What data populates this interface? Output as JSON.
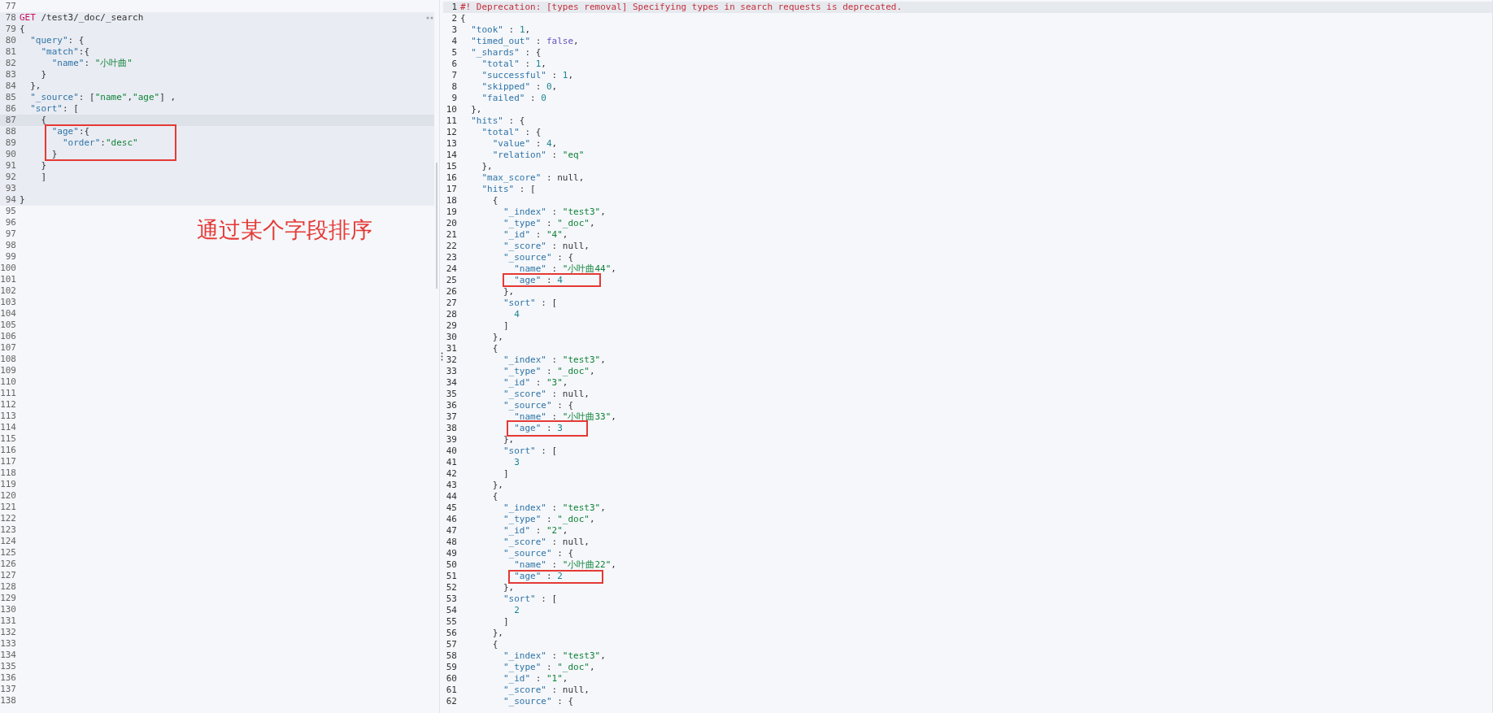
{
  "request_editor": {
    "lines_above": [
      {
        "n": "77"
      }
    ],
    "request": {
      "lines": [
        {
          "n": "78",
          "current": false,
          "code": [
            {
              "kind": "method",
              "text": "GET"
            },
            {
              "kind": "path",
              "text": " /test3/_doc/_search"
            }
          ]
        },
        {
          "n": "79",
          "current": false,
          "code": [
            {
              "kind": "punct",
              "text": "{"
            }
          ]
        },
        {
          "n": "80",
          "current": false,
          "code": [
            {
              "kind": "key",
              "text": "  \"query\""
            },
            {
              "kind": "punct",
              "text": ": {"
            }
          ]
        },
        {
          "n": "81",
          "current": false,
          "code": [
            {
              "kind": "key",
              "text": "    \"match\""
            },
            {
              "kind": "punct",
              "text": ":{"
            }
          ]
        },
        {
          "n": "82",
          "current": false,
          "code": [
            {
              "kind": "key",
              "text": "      \"name\""
            },
            {
              "kind": "punct",
              "text": ": "
            },
            {
              "kind": "str",
              "text": "\"小叶曲\""
            }
          ]
        },
        {
          "n": "83",
          "current": false,
          "code": [
            {
              "kind": "punct",
              "text": "    }"
            }
          ]
        },
        {
          "n": "84",
          "current": false,
          "code": [
            {
              "kind": "punct",
              "text": "  },"
            }
          ]
        },
        {
          "n": "85",
          "current": false,
          "code": [
            {
              "kind": "key",
              "text": "  \"_source\""
            },
            {
              "kind": "punct",
              "text": ": ["
            },
            {
              "kind": "str",
              "text": "\"name\""
            },
            {
              "kind": "punct",
              "text": ","
            },
            {
              "kind": "str",
              "text": "\"age\""
            },
            {
              "kind": "punct",
              "text": "] ,"
            }
          ]
        },
        {
          "n": "86",
          "current": false,
          "code": [
            {
              "kind": "key",
              "text": "  \"sort\""
            },
            {
              "kind": "punct",
              "text": ": ["
            }
          ]
        },
        {
          "n": "87",
          "current": true,
          "code": [
            {
              "kind": "punct",
              "text": "    {"
            }
          ]
        },
        {
          "n": "88",
          "current": false,
          "code": [
            {
              "kind": "key",
              "text": "      \"age\""
            },
            {
              "kind": "punct",
              "text": ":{"
            }
          ]
        },
        {
          "n": "89",
          "current": false,
          "code": [
            {
              "kind": "key",
              "text": "        \"order\""
            },
            {
              "kind": "punct",
              "text": ":"
            },
            {
              "kind": "str",
              "text": "\"desc\""
            }
          ]
        },
        {
          "n": "90",
          "current": false,
          "code": [
            {
              "kind": "punct",
              "text": "      }"
            }
          ]
        },
        {
          "n": "91",
          "current": false,
          "code": [
            {
              "kind": "punct",
              "text": "    }"
            }
          ]
        },
        {
          "n": "92",
          "current": false,
          "code": [
            {
              "kind": "punct",
              "text": "    ]"
            }
          ]
        },
        {
          "n": "93",
          "current": false
        },
        {
          "n": "94",
          "current": false,
          "code": [
            {
              "kind": "punct",
              "text": "}"
            }
          ]
        }
      ]
    },
    "lines_below": [
      {
        "n": "95"
      },
      {
        "n": "96"
      },
      {
        "n": "97"
      },
      {
        "n": "98"
      },
      {
        "n": "99"
      },
      {
        "n": "100"
      },
      {
        "n": "101"
      },
      {
        "n": "102"
      },
      {
        "n": "103"
      },
      {
        "n": "104"
      },
      {
        "n": "105"
      },
      {
        "n": "106"
      },
      {
        "n": "107"
      },
      {
        "n": "108"
      },
      {
        "n": "109"
      },
      {
        "n": "110"
      },
      {
        "n": "111"
      },
      {
        "n": "112"
      },
      {
        "n": "113"
      },
      {
        "n": "114"
      },
      {
        "n": "115"
      },
      {
        "n": "116"
      },
      {
        "n": "117"
      },
      {
        "n": "118"
      },
      {
        "n": "119"
      },
      {
        "n": "120"
      },
      {
        "n": "121"
      },
      {
        "n": "122"
      },
      {
        "n": "123"
      },
      {
        "n": "124"
      },
      {
        "n": "125"
      },
      {
        "n": "126"
      },
      {
        "n": "127"
      },
      {
        "n": "128"
      },
      {
        "n": "129"
      },
      {
        "n": "130"
      },
      {
        "n": "131"
      },
      {
        "n": "132"
      },
      {
        "n": "133"
      },
      {
        "n": "134"
      },
      {
        "n": "135"
      },
      {
        "n": "136"
      },
      {
        "n": "137"
      },
      {
        "n": "138"
      }
    ],
    "annotation": "通过某个字段排序"
  },
  "response_viewer": {
    "warning": {
      "n": "1",
      "text": "#! Deprecation: [types removal] Specifying types in search requests is deprecated."
    },
    "lines": [
      {
        "n": "2",
        "code": [
          {
            "kind": "punct",
            "text": "{"
          }
        ]
      },
      {
        "n": "3",
        "code": [
          {
            "kind": "key",
            "text": "  \"took\""
          },
          {
            "kind": "punct",
            "text": " : "
          },
          {
            "kind": "num",
            "text": "1"
          },
          {
            "kind": "punct",
            "text": ","
          }
        ]
      },
      {
        "n": "4",
        "code": [
          {
            "kind": "key",
            "text": "  \"timed_out\""
          },
          {
            "kind": "punct",
            "text": " : "
          },
          {
            "kind": "bool",
            "text": "false"
          },
          {
            "kind": "punct",
            "text": ","
          }
        ]
      },
      {
        "n": "5",
        "code": [
          {
            "kind": "key",
            "text": "  \"_shards\""
          },
          {
            "kind": "punct",
            "text": " : {"
          }
        ]
      },
      {
        "n": "6",
        "code": [
          {
            "kind": "key",
            "text": "    \"total\""
          },
          {
            "kind": "punct",
            "text": " : "
          },
          {
            "kind": "num",
            "text": "1"
          },
          {
            "kind": "punct",
            "text": ","
          }
        ]
      },
      {
        "n": "7",
        "code": [
          {
            "kind": "key",
            "text": "    \"successful\""
          },
          {
            "kind": "punct",
            "text": " : "
          },
          {
            "kind": "num",
            "text": "1"
          },
          {
            "kind": "punct",
            "text": ","
          }
        ]
      },
      {
        "n": "8",
        "code": [
          {
            "kind": "key",
            "text": "    \"skipped\""
          },
          {
            "kind": "punct",
            "text": " : "
          },
          {
            "kind": "num",
            "text": "0"
          },
          {
            "kind": "punct",
            "text": ","
          }
        ]
      },
      {
        "n": "9",
        "code": [
          {
            "kind": "key",
            "text": "    \"failed\""
          },
          {
            "kind": "punct",
            "text": " : "
          },
          {
            "kind": "num",
            "text": "0"
          }
        ]
      },
      {
        "n": "10",
        "code": [
          {
            "kind": "punct",
            "text": "  },"
          }
        ]
      },
      {
        "n": "11",
        "code": [
          {
            "kind": "key",
            "text": "  \"hits\""
          },
          {
            "kind": "punct",
            "text": " : {"
          }
        ]
      },
      {
        "n": "12",
        "code": [
          {
            "kind": "key",
            "text": "    \"total\""
          },
          {
            "kind": "punct",
            "text": " : {"
          }
        ]
      },
      {
        "n": "13",
        "code": [
          {
            "kind": "key",
            "text": "      \"value\""
          },
          {
            "kind": "punct",
            "text": " : "
          },
          {
            "kind": "num",
            "text": "4"
          },
          {
            "kind": "punct",
            "text": ","
          }
        ]
      },
      {
        "n": "14",
        "code": [
          {
            "kind": "key",
            "text": "      \"relation\""
          },
          {
            "kind": "punct",
            "text": " : "
          },
          {
            "kind": "str",
            "text": "\"eq\""
          }
        ]
      },
      {
        "n": "15",
        "code": [
          {
            "kind": "punct",
            "text": "    },"
          }
        ]
      },
      {
        "n": "16",
        "code": [
          {
            "kind": "key",
            "text": "    \"max_score\""
          },
          {
            "kind": "punct",
            "text": " : null,"
          }
        ]
      },
      {
        "n": "17",
        "code": [
          {
            "kind": "key",
            "text": "    \"hits\""
          },
          {
            "kind": "punct",
            "text": " : ["
          }
        ]
      },
      {
        "n": "18",
        "code": [
          {
            "kind": "punct",
            "text": "      {"
          }
        ]
      },
      {
        "n": "19",
        "code": [
          {
            "kind": "key",
            "text": "        \"_index\""
          },
          {
            "kind": "punct",
            "text": " : "
          },
          {
            "kind": "str",
            "text": "\"test3\""
          },
          {
            "kind": "punct",
            "text": ","
          }
        ]
      },
      {
        "n": "20",
        "code": [
          {
            "kind": "key",
            "text": "        \"_type\""
          },
          {
            "kind": "punct",
            "text": " : "
          },
          {
            "kind": "str",
            "text": "\"_doc\""
          },
          {
            "kind": "punct",
            "text": ","
          }
        ]
      },
      {
        "n": "21",
        "code": [
          {
            "kind": "key",
            "text": "        \"_id\""
          },
          {
            "kind": "punct",
            "text": " : "
          },
          {
            "kind": "str",
            "text": "\"4\""
          },
          {
            "kind": "punct",
            "text": ","
          }
        ]
      },
      {
        "n": "22",
        "code": [
          {
            "kind": "key",
            "text": "        \"_score\""
          },
          {
            "kind": "punct",
            "text": " : null,"
          }
        ]
      },
      {
        "n": "23",
        "code": [
          {
            "kind": "key",
            "text": "        \"_source\""
          },
          {
            "kind": "punct",
            "text": " : {"
          }
        ]
      },
      {
        "n": "24",
        "code": [
          {
            "kind": "key",
            "text": "          \"name\""
          },
          {
            "kind": "punct",
            "text": " : "
          },
          {
            "kind": "str",
            "text": "\"小叶曲44\""
          },
          {
            "kind": "punct",
            "text": ","
          }
        ]
      },
      {
        "n": "25",
        "code": [
          {
            "kind": "key",
            "text": "          \"age\""
          },
          {
            "kind": "punct",
            "text": " : "
          },
          {
            "kind": "num",
            "text": "4"
          }
        ]
      },
      {
        "n": "26",
        "code": [
          {
            "kind": "punct",
            "text": "        },"
          }
        ]
      },
      {
        "n": "27",
        "code": [
          {
            "kind": "key",
            "text": "        \"sort\""
          },
          {
            "kind": "punct",
            "text": " : ["
          }
        ]
      },
      {
        "n": "28",
        "code": [
          {
            "kind": "num",
            "text": "          4"
          }
        ]
      },
      {
        "n": "29",
        "code": [
          {
            "kind": "punct",
            "text": "        ]"
          }
        ]
      },
      {
        "n": "30",
        "code": [
          {
            "kind": "punct",
            "text": "      },"
          }
        ]
      },
      {
        "n": "31",
        "code": [
          {
            "kind": "punct",
            "text": "      {"
          }
        ]
      },
      {
        "n": "32",
        "code": [
          {
            "kind": "key",
            "text": "        \"_index\""
          },
          {
            "kind": "punct",
            "text": " : "
          },
          {
            "kind": "str",
            "text": "\"test3\""
          },
          {
            "kind": "punct",
            "text": ","
          }
        ]
      },
      {
        "n": "33",
        "code": [
          {
            "kind": "key",
            "text": "        \"_type\""
          },
          {
            "kind": "punct",
            "text": " : "
          },
          {
            "kind": "str",
            "text": "\"_doc\""
          },
          {
            "kind": "punct",
            "text": ","
          }
        ]
      },
      {
        "n": "34",
        "code": [
          {
            "kind": "key",
            "text": "        \"_id\""
          },
          {
            "kind": "punct",
            "text": " : "
          },
          {
            "kind": "str",
            "text": "\"3\""
          },
          {
            "kind": "punct",
            "text": ","
          }
        ]
      },
      {
        "n": "35",
        "code": [
          {
            "kind": "key",
            "text": "        \"_score\""
          },
          {
            "kind": "punct",
            "text": " : null,"
          }
        ]
      },
      {
        "n": "36",
        "code": [
          {
            "kind": "key",
            "text": "        \"_source\""
          },
          {
            "kind": "punct",
            "text": " : {"
          }
        ]
      },
      {
        "n": "37",
        "code": [
          {
            "kind": "key",
            "text": "          \"name\""
          },
          {
            "kind": "punct",
            "text": " : "
          },
          {
            "kind": "str",
            "text": "\"小叶曲33\""
          },
          {
            "kind": "punct",
            "text": ","
          }
        ]
      },
      {
        "n": "38",
        "code": [
          {
            "kind": "key",
            "text": "          \"age\""
          },
          {
            "kind": "punct",
            "text": " : "
          },
          {
            "kind": "num",
            "text": "3"
          }
        ]
      },
      {
        "n": "39",
        "code": [
          {
            "kind": "punct",
            "text": "        },"
          }
        ]
      },
      {
        "n": "40",
        "code": [
          {
            "kind": "key",
            "text": "        \"sort\""
          },
          {
            "kind": "punct",
            "text": " : ["
          }
        ]
      },
      {
        "n": "41",
        "code": [
          {
            "kind": "num",
            "text": "          3"
          }
        ]
      },
      {
        "n": "42",
        "code": [
          {
            "kind": "punct",
            "text": "        ]"
          }
        ]
      },
      {
        "n": "43",
        "code": [
          {
            "kind": "punct",
            "text": "      },"
          }
        ]
      },
      {
        "n": "44",
        "code": [
          {
            "kind": "punct",
            "text": "      {"
          }
        ]
      },
      {
        "n": "45",
        "code": [
          {
            "kind": "key",
            "text": "        \"_index\""
          },
          {
            "kind": "punct",
            "text": " : "
          },
          {
            "kind": "str",
            "text": "\"test3\""
          },
          {
            "kind": "punct",
            "text": ","
          }
        ]
      },
      {
        "n": "46",
        "code": [
          {
            "kind": "key",
            "text": "        \"_type\""
          },
          {
            "kind": "punct",
            "text": " : "
          },
          {
            "kind": "str",
            "text": "\"_doc\""
          },
          {
            "kind": "punct",
            "text": ","
          }
        ]
      },
      {
        "n": "47",
        "code": [
          {
            "kind": "key",
            "text": "        \"_id\""
          },
          {
            "kind": "punct",
            "text": " : "
          },
          {
            "kind": "str",
            "text": "\"2\""
          },
          {
            "kind": "punct",
            "text": ","
          }
        ]
      },
      {
        "n": "48",
        "code": [
          {
            "kind": "key",
            "text": "        \"_score\""
          },
          {
            "kind": "punct",
            "text": " : null,"
          }
        ]
      },
      {
        "n": "49",
        "code": [
          {
            "kind": "key",
            "text": "        \"_source\""
          },
          {
            "kind": "punct",
            "text": " : {"
          }
        ]
      },
      {
        "n": "50",
        "code": [
          {
            "kind": "key",
            "text": "          \"name\""
          },
          {
            "kind": "punct",
            "text": " : "
          },
          {
            "kind": "str",
            "text": "\"小叶曲22\""
          },
          {
            "kind": "punct",
            "text": ","
          }
        ]
      },
      {
        "n": "51",
        "code": [
          {
            "kind": "key",
            "text": "          \"age\""
          },
          {
            "kind": "punct",
            "text": " : "
          },
          {
            "kind": "num",
            "text": "2"
          }
        ]
      },
      {
        "n": "52",
        "code": [
          {
            "kind": "punct",
            "text": "        },"
          }
        ]
      },
      {
        "n": "53",
        "code": [
          {
            "kind": "key",
            "text": "        \"sort\""
          },
          {
            "kind": "punct",
            "text": " : ["
          }
        ]
      },
      {
        "n": "54",
        "code": [
          {
            "kind": "num",
            "text": "          2"
          }
        ]
      },
      {
        "n": "55",
        "code": [
          {
            "kind": "punct",
            "text": "        ]"
          }
        ]
      },
      {
        "n": "56",
        "code": [
          {
            "kind": "punct",
            "text": "      },"
          }
        ]
      },
      {
        "n": "57",
        "code": [
          {
            "kind": "punct",
            "text": "      {"
          }
        ]
      },
      {
        "n": "58",
        "code": [
          {
            "kind": "key",
            "text": "        \"_index\""
          },
          {
            "kind": "punct",
            "text": " : "
          },
          {
            "kind": "str",
            "text": "\"test3\""
          },
          {
            "kind": "punct",
            "text": ","
          }
        ]
      },
      {
        "n": "59",
        "code": [
          {
            "kind": "key",
            "text": "        \"_type\""
          },
          {
            "kind": "punct",
            "text": " : "
          },
          {
            "kind": "str",
            "text": "\"_doc\""
          },
          {
            "kind": "punct",
            "text": ","
          }
        ]
      },
      {
        "n": "60",
        "code": [
          {
            "kind": "key",
            "text": "        \"_id\""
          },
          {
            "kind": "punct",
            "text": " : "
          },
          {
            "kind": "str",
            "text": "\"1\""
          },
          {
            "kind": "punct",
            "text": ","
          }
        ]
      },
      {
        "n": "61",
        "code": [
          {
            "kind": "key",
            "text": "        \"_score\""
          },
          {
            "kind": "punct",
            "text": " : null,"
          }
        ]
      },
      {
        "n": "62",
        "code": [
          {
            "kind": "key",
            "text": "        \"_source\""
          },
          {
            "kind": "punct",
            "text": " : {"
          }
        ]
      }
    ]
  }
}
